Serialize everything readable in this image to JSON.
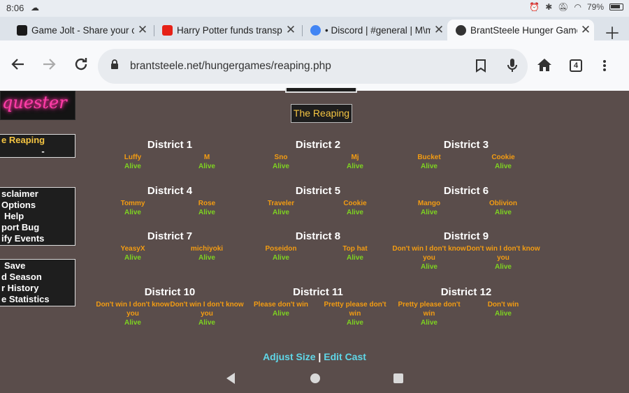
{
  "status": {
    "time": "8:06",
    "battery": "79%"
  },
  "tabs": [
    {
      "title": "Game Jolt - Share your creations",
      "favicon_color": "#1a1a1a"
    },
    {
      "title": "Harry Potter funds transphobia",
      "favicon_color": "#e62117"
    },
    {
      "title": "• Discord | #general | M\\ma",
      "favicon_color": "#4285f4"
    },
    {
      "title": "BrantSteele Hunger Games",
      "favicon_color": "#333333"
    }
  ],
  "omnibox": {
    "url": "brantsteele.net/hungergames/reaping.php",
    "tab_count": "4"
  },
  "page": {
    "logo_text": "quester",
    "reaping_button": "The Reaping",
    "sidebar_box1": {
      "current": "e Reaping",
      "dash": "-"
    },
    "sidebar_box2": [
      "sclaimer",
      "Options",
      "Help",
      "port Bug",
      "ify Events"
    ],
    "sidebar_box3": [
      "Save",
      "d Season",
      "r History",
      "e Statistics"
    ],
    "districts": [
      {
        "name": "District 1",
        "tributes": [
          {
            "name": "Luffy",
            "status": "Alive"
          },
          {
            "name": "M",
            "status": "Alive"
          }
        ]
      },
      {
        "name": "District 2",
        "tributes": [
          {
            "name": "Sno",
            "status": "Alive"
          },
          {
            "name": "Mj",
            "status": "Alive"
          }
        ]
      },
      {
        "name": "District 3",
        "tributes": [
          {
            "name": "Bucket",
            "status": "Alive"
          },
          {
            "name": "Cookie",
            "status": "Alive"
          }
        ]
      },
      {
        "name": "District 4",
        "tributes": [
          {
            "name": "Tommy",
            "status": "Alive"
          },
          {
            "name": "Rose",
            "status": "Alive"
          }
        ]
      },
      {
        "name": "District 5",
        "tributes": [
          {
            "name": "Traveler",
            "status": "Alive"
          },
          {
            "name": "Cookie",
            "status": "Alive"
          }
        ]
      },
      {
        "name": "District 6",
        "tributes": [
          {
            "name": "Mango",
            "status": "Alive"
          },
          {
            "name": "Oblivion",
            "status": "Alive"
          }
        ]
      },
      {
        "name": "District 7",
        "tributes": [
          {
            "name": "YeasyX",
            "status": "Alive"
          },
          {
            "name": "michiyoki",
            "status": "Alive"
          }
        ]
      },
      {
        "name": "District 8",
        "tributes": [
          {
            "name": "Poseidon",
            "status": "Alive"
          },
          {
            "name": "Top hat",
            "status": "Alive"
          }
        ]
      },
      {
        "name": "District 9",
        "tributes": [
          {
            "name": "Don't win I don't know you",
            "status": "Alive"
          },
          {
            "name": "Don't win I don't know you",
            "status": "Alive"
          }
        ]
      },
      {
        "name": "District 10",
        "tributes": [
          {
            "name": "Don't win I don't know you",
            "status": "Alive"
          },
          {
            "name": "Don't win I don't know you",
            "status": "Alive"
          }
        ]
      },
      {
        "name": "District 11",
        "tributes": [
          {
            "name": "Please don't win",
            "status": "Alive"
          },
          {
            "name": "Pretty please don't win",
            "status": "Alive"
          }
        ]
      },
      {
        "name": "District 12",
        "tributes": [
          {
            "name": "Pretty please don't win",
            "status": "Alive"
          },
          {
            "name": "Don't win",
            "status": "Alive"
          }
        ]
      }
    ],
    "adjust_size": "Adjust Size",
    "separator": " | ",
    "edit_cast": "Edit Cast"
  },
  "icons": {
    "status_cloud": "cloud-icon",
    "back": "back-arrow-icon",
    "forward": "forward-arrow-icon",
    "reload": "reload-icon",
    "lock": "lock-icon",
    "bookmark": "bookmark-icon",
    "mic": "mic-icon",
    "home": "home-icon",
    "menu": "kebab-menu-icon"
  }
}
